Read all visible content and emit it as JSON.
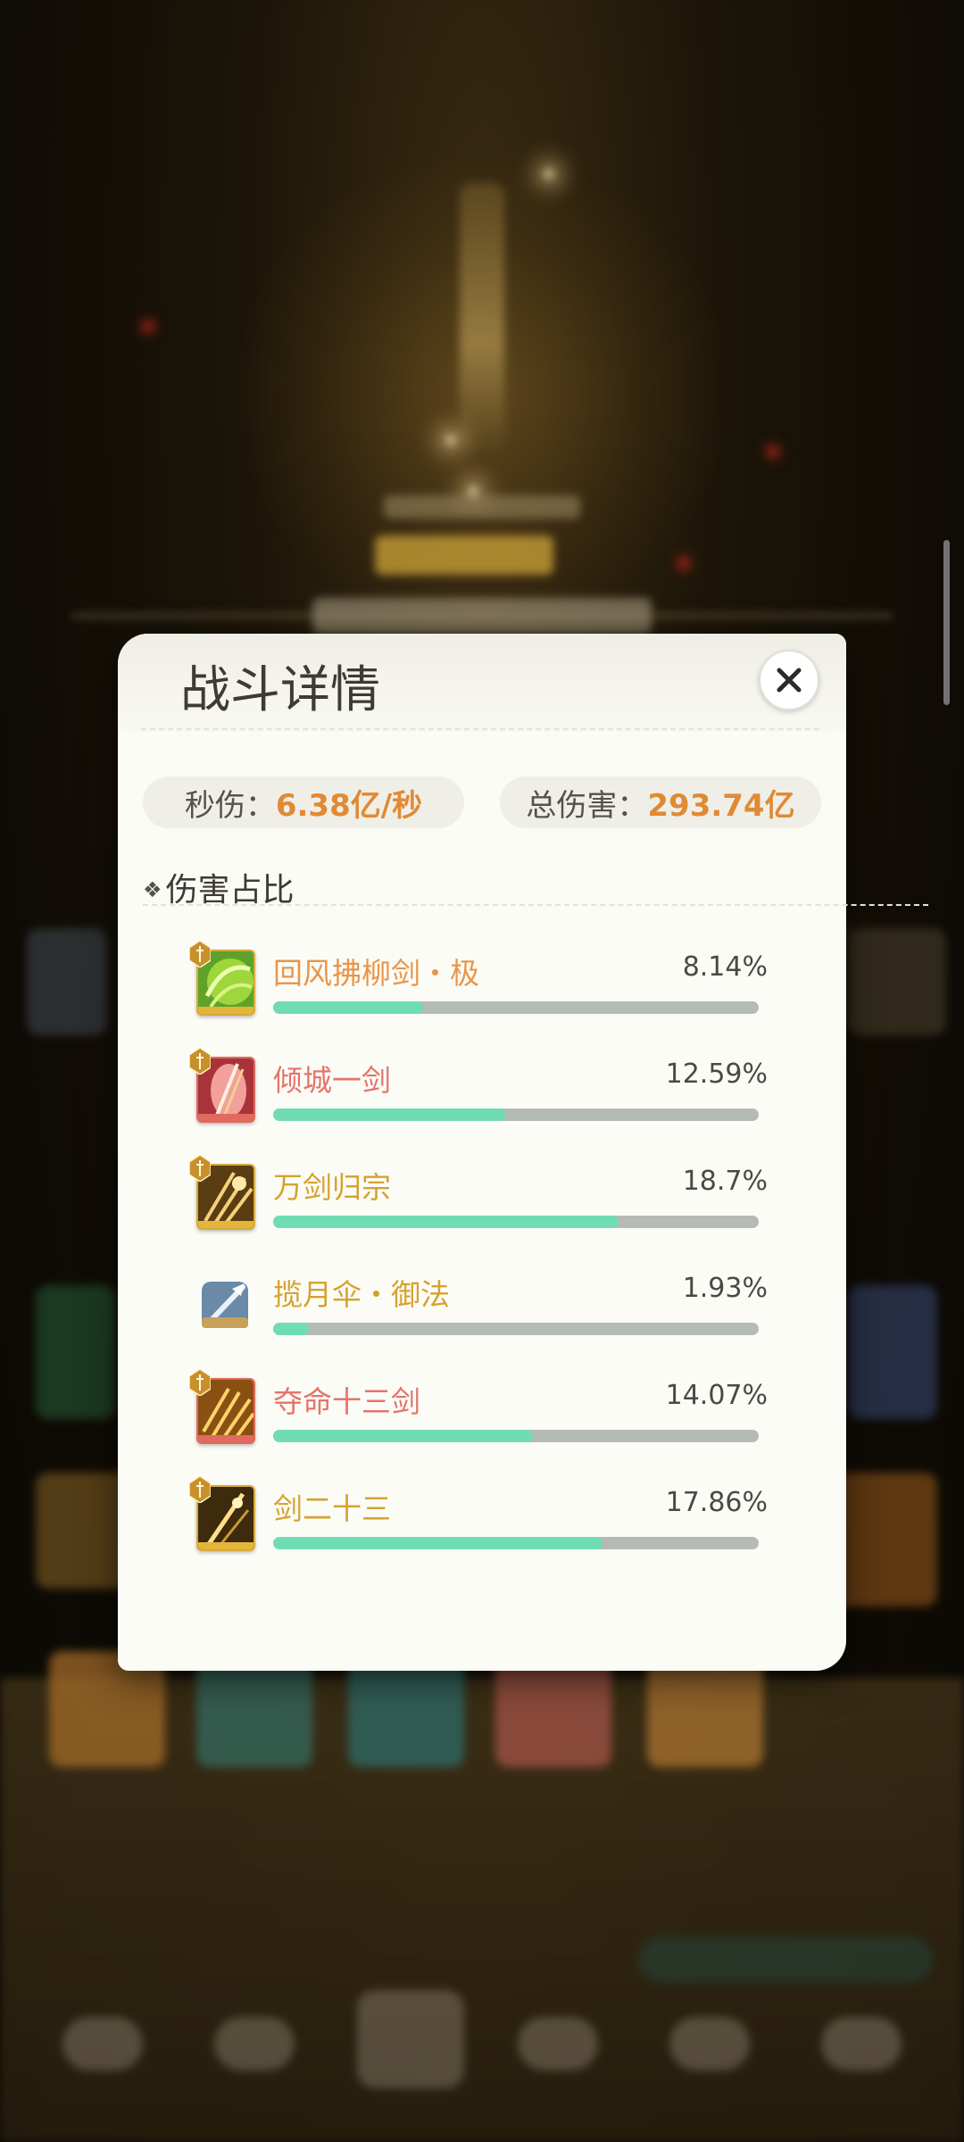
{
  "dialog": {
    "title": "战斗详情",
    "close_icon": "close-icon"
  },
  "stats": {
    "dps_label": "秒伤：",
    "dps_value": "6.38亿/秒",
    "total_label": "总伤害：",
    "total_value": "293.74亿"
  },
  "section": {
    "title": "伤害占比",
    "icon": "diamond-icon"
  },
  "skills": [
    {
      "name": "回风拂柳剑・极",
      "percent": "8.14%",
      "ratio": 0.3095,
      "name_color": "#e8964a",
      "icon": "wind-sword-icon"
    },
    {
      "name": "倾城一剑",
      "percent": "12.59%",
      "ratio": 0.4787,
      "name_color": "#e5746a",
      "icon": "crimson-sword-icon"
    },
    {
      "name": "万剑归宗",
      "percent": "18.7%",
      "ratio": 0.711,
      "name_color": "#d6a22e",
      "icon": "ten-thousand-swords-icon"
    },
    {
      "name": "揽月伞・御法",
      "percent": "1.93%",
      "ratio": 0.0734,
      "name_color": "#d6a22e",
      "icon": "moon-umbrella-icon"
    },
    {
      "name": "夺命十三剑",
      "percent": "14.07%",
      "ratio": 0.535,
      "name_color": "#e5746a",
      "icon": "thirteen-swords-icon"
    },
    {
      "name": "剑二十三",
      "percent": "17.86%",
      "ratio": 0.679,
      "name_color": "#d6a22e",
      "icon": "sword-twenty-three-icon"
    }
  ],
  "colors": {
    "accent_value": "#e08a35",
    "progress_fill": "#6fdcb6",
    "progress_track": "#b4bab6"
  }
}
